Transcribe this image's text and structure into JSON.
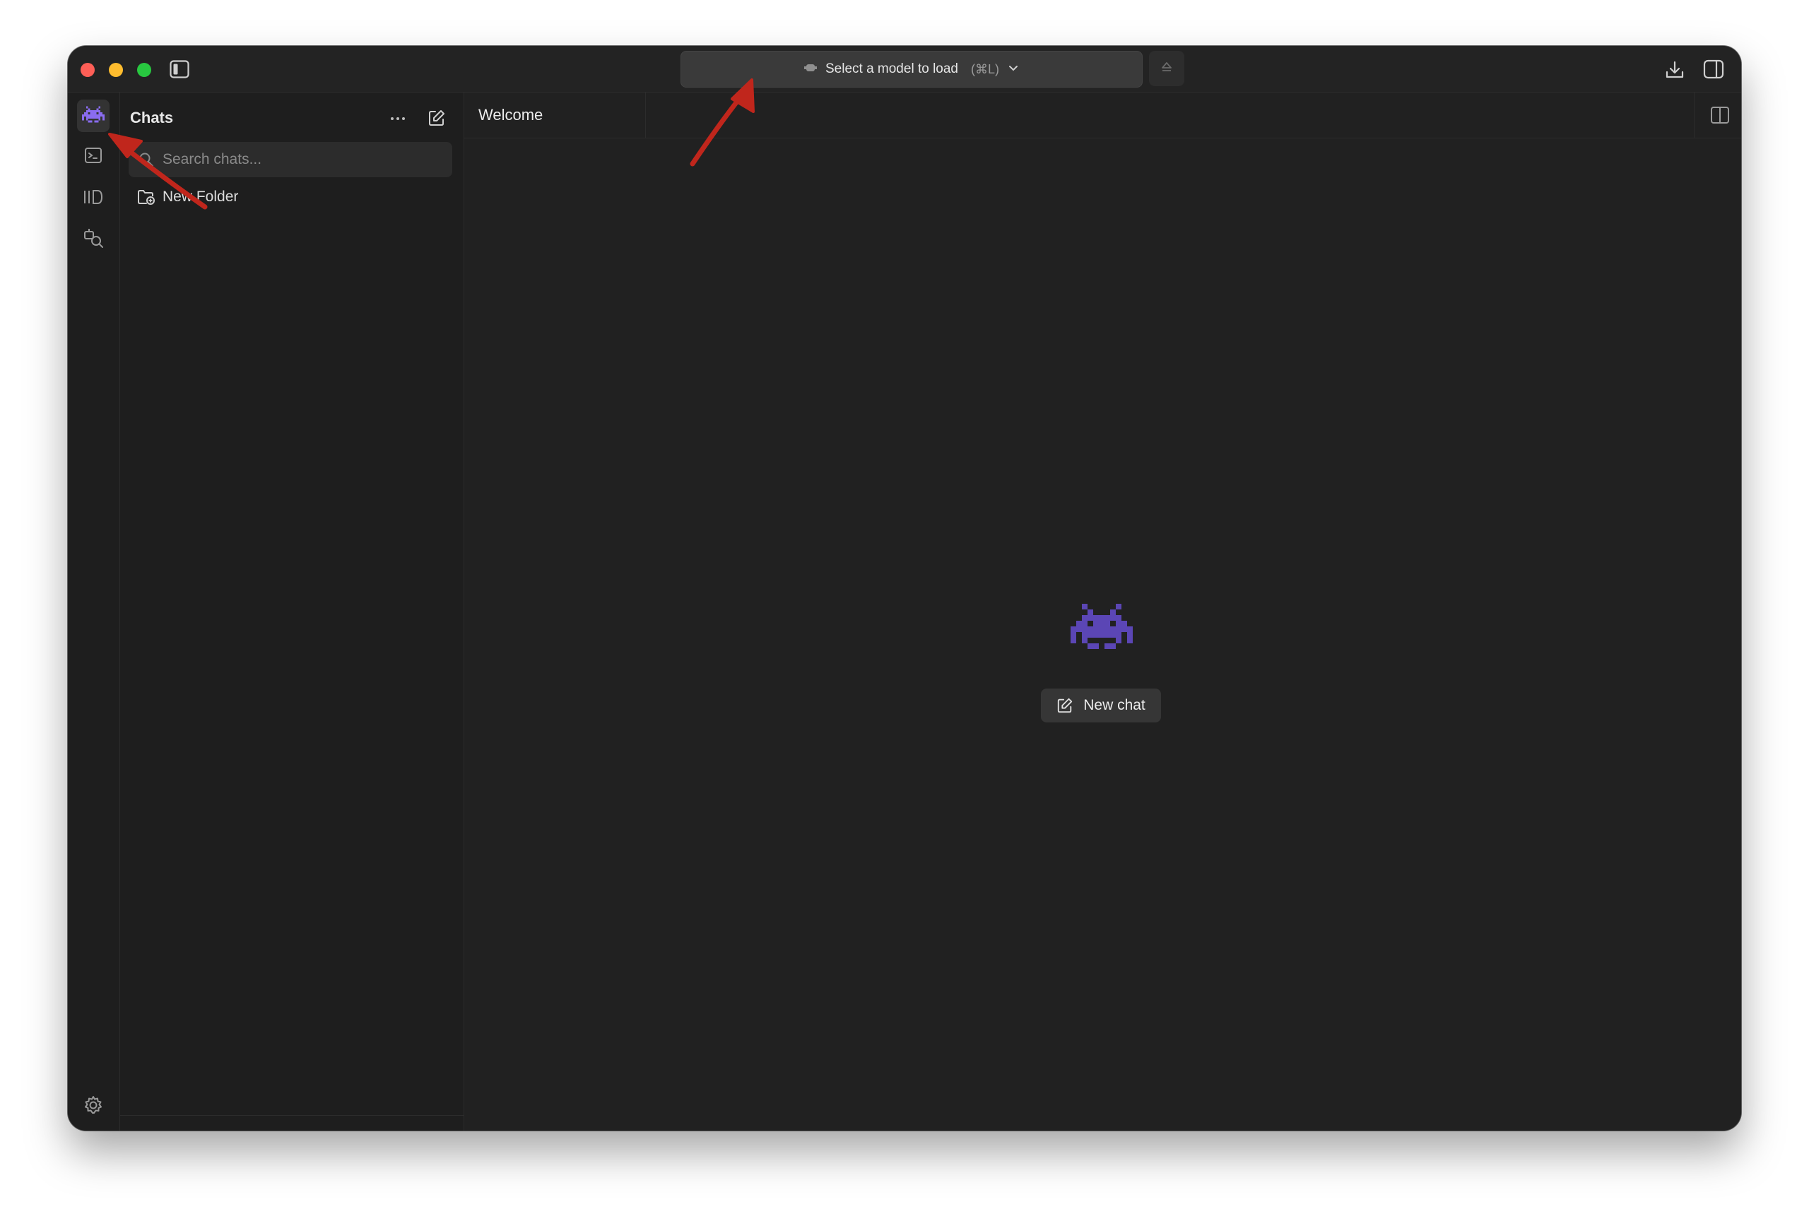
{
  "titlebar": {
    "model_selector_label": "Select a model to load",
    "model_selector_shortcut": "(⌘L)"
  },
  "sidebar": {
    "title": "Chats",
    "search_placeholder": "Search chats...",
    "folder_label": "New Folder"
  },
  "main": {
    "tab_label": "Welcome",
    "new_chat_label": "New chat"
  },
  "colors": {
    "accent_purple": "#5b46b5",
    "annotation_red": "#c0261c",
    "window_bg": "#212121"
  }
}
